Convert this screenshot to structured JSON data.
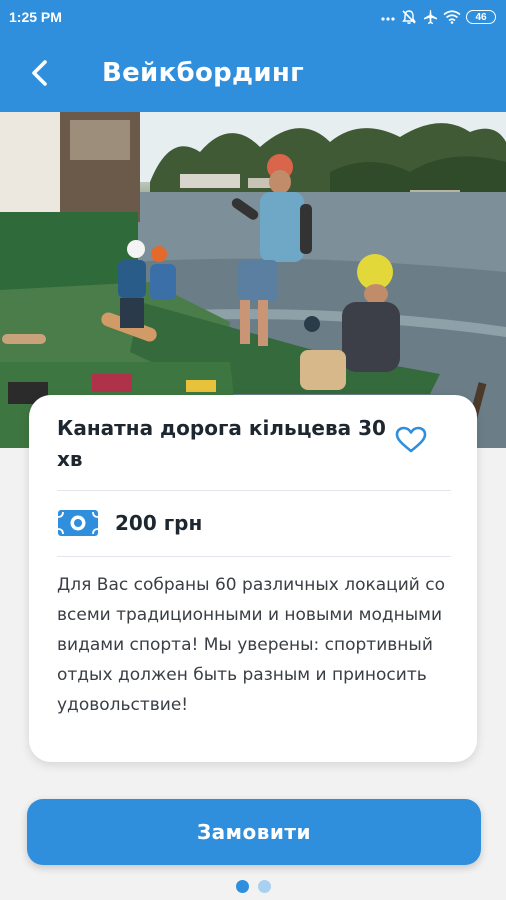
{
  "status_bar": {
    "time": "1:25 PM",
    "battery_level": "46",
    "icons": [
      "dots-icon",
      "mute-bell-icon",
      "airplane-icon",
      "wifi-icon",
      "battery-icon"
    ]
  },
  "header": {
    "title": "Вейкбординг",
    "back_icon": "back-arrow-icon"
  },
  "hero": {
    "image": "wakeboarding-photo"
  },
  "card": {
    "title": "Канатна дорога кільцева 30 хв",
    "favorite_icon": "heart-outline-icon",
    "price_icon": "banknote-icon",
    "price": "200 грн",
    "description": "Для Вас собраны 60 различных локаций со всеми традиционными и новыми модными видами спорта! Мы уверены: спортивный отдых должен быть разным и приносить удовольствие!"
  },
  "order_button": {
    "label": "Замовити"
  },
  "pager": {
    "count": 2,
    "active_index": 0
  },
  "colors": {
    "accent": "#2f8fdc",
    "text": "#1e2730",
    "background": "#f2f2f2",
    "card": "#ffffff"
  }
}
